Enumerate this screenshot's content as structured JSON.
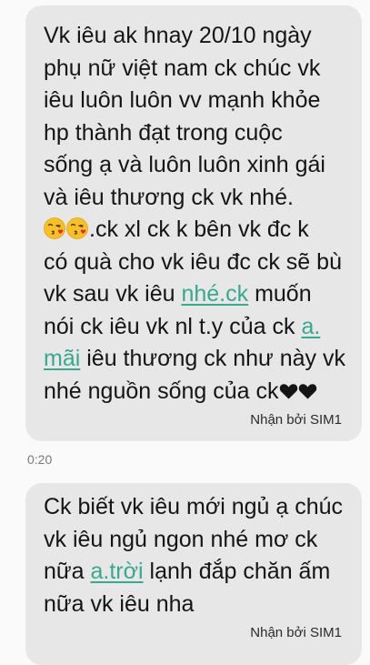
{
  "messages": [
    {
      "lines": [
        "Vk iêu ak hnay 20/10 ngày",
        "phụ nữ việt nam ck chúc vk",
        "iêu luôn luôn vv mạnh khỏe",
        "hp thành đạt trong cuộc",
        "sống ạ và luôn luôn xinh gái",
        "và iêu thương ck vk nhé."
      ],
      "line7_text": ".ck xl ck k bên vk đc k",
      "line8": "có quà cho vk iêu đc ck sẽ bù",
      "line9_pre": "vk sau vk iêu ",
      "line9_link": "nhé.ck",
      "line9_post": " muốn",
      "line10_pre": "nói ck iêu vk nl t.y của ck ",
      "line10_link": "a.",
      "line11_link": "mãi",
      "line11_post": " iêu thương ck như này vk",
      "line12": "nhé nguồn sống của ck",
      "emoji_icons": [
        "kissing-face-with-heart-icon",
        "kissing-face-with-heart-icon"
      ],
      "heart_icons": [
        "black-heart-icon",
        "black-heart-icon"
      ],
      "receipt": "Nhận bởi SIM1"
    },
    {
      "lines": [
        "Ck biết vk iêu mới ngủ ạ chúc",
        "vk iêu ngủ ngon nhé mơ ck"
      ],
      "line3_pre": "nữa ",
      "line3_link": "a.trời",
      "line3_post": " lạnh đắp chăn ấm",
      "line4": "nữa vk iêu nha",
      "receipt": "Nhận bởi SIM1"
    }
  ],
  "timestamp": "0:20",
  "colors": {
    "bubble": "#e7e7e7",
    "link": "#3aa88f",
    "background": "#fafafa"
  }
}
